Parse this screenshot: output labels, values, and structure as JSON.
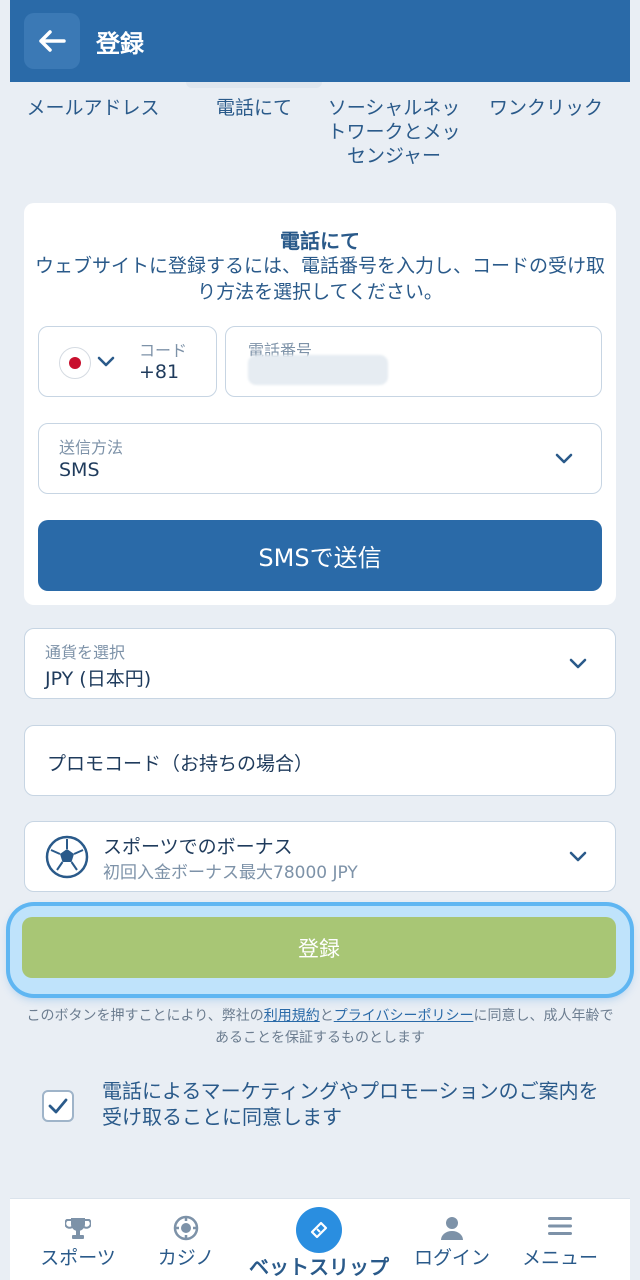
{
  "header": {
    "title": "登録",
    "back_icon": "arrow-left-icon"
  },
  "tabs": [
    {
      "label": "メールアドレス"
    },
    {
      "label": "電話にて"
    },
    {
      "label": "ソーシャルネットワークとメッセンジャー"
    },
    {
      "label": "ワンクリック"
    }
  ],
  "phone_card": {
    "title": "電話にて",
    "description": "ウェブサイトに登録するには、電話番号を入力し、コードの受け取り方法を選択してください。",
    "code_label": "コード",
    "code_value": "+81",
    "phone_label": "電話番号",
    "send_method_label": "送信方法",
    "send_method_value": "SMS",
    "send_button": "SMSで送信"
  },
  "currency": {
    "label": "通貨を選択",
    "value": "JPY (日本円)"
  },
  "promo": {
    "placeholder": "プロモコード（お持ちの場合）"
  },
  "bonus": {
    "title": "スポーツでのボーナス",
    "subtitle": "初回入金ボーナス最大78000 JPY",
    "icon": "soccer-ball-icon"
  },
  "register_button": "登録",
  "legal": {
    "prefix": "このボタンを押すことにより、弊社の",
    "terms_link": "利用規約",
    "and": "と",
    "privacy_link": "プライバシーポリシー",
    "suffix": "に同意し、成人年齢であることを保証するものとします"
  },
  "consent": {
    "text": "電話によるマーケティングやプロモーションのご案内を受け取ることに同意します",
    "checked": true
  },
  "bottom_nav": [
    {
      "label": "スポーツ",
      "icon": "trophy-icon"
    },
    {
      "label": "カジノ",
      "icon": "casino-chip-icon"
    },
    {
      "label": "ベットスリップ",
      "icon": "ticket-icon"
    },
    {
      "label": "ログイン",
      "icon": "user-icon"
    },
    {
      "label": "メニュー",
      "icon": "menu-icon"
    }
  ],
  "colors": {
    "primary": "#2a6aa8",
    "register": "#a8c675",
    "background": "#e9eef4"
  }
}
